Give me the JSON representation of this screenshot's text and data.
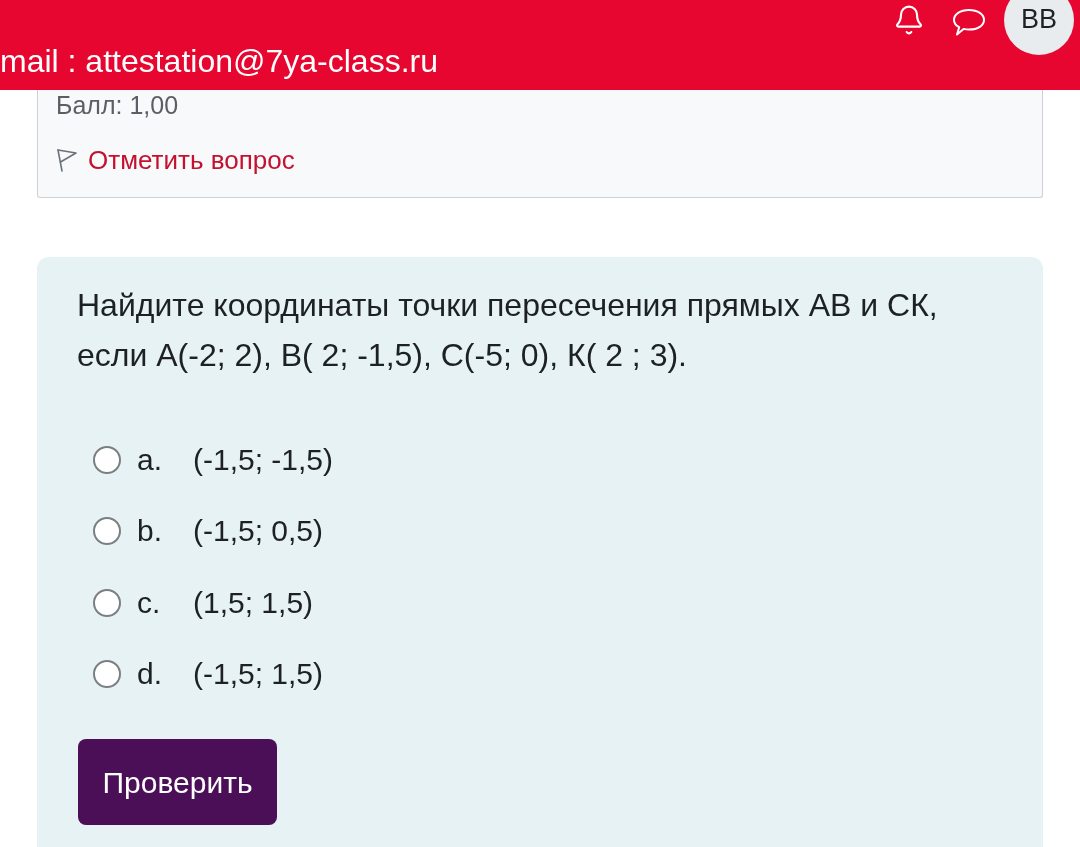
{
  "header": {
    "email": "mail : attestation@7ya-class.ru",
    "avatar": "BB"
  },
  "info": {
    "grade": "Балл: 1,00",
    "flag_link": "Отметить вопрос"
  },
  "question": {
    "text": "Найдите координаты точки пересечения прямых АВ и СК, если А(-2; 2), В( 2; -1,5), С(-5; 0), К( 2 ; 3).",
    "options": [
      {
        "letter": "a.",
        "text": "(-1,5; -1,5)",
        "selected": false
      },
      {
        "letter": "b.",
        "text": "(-1,5; 0,5)",
        "selected": false
      },
      {
        "letter": "c.",
        "text": "(1,5; 1,5)",
        "selected": false
      },
      {
        "letter": "d.",
        "text": "(-1,5; 1,5)",
        "selected": false
      }
    ],
    "button": "Проверить"
  }
}
